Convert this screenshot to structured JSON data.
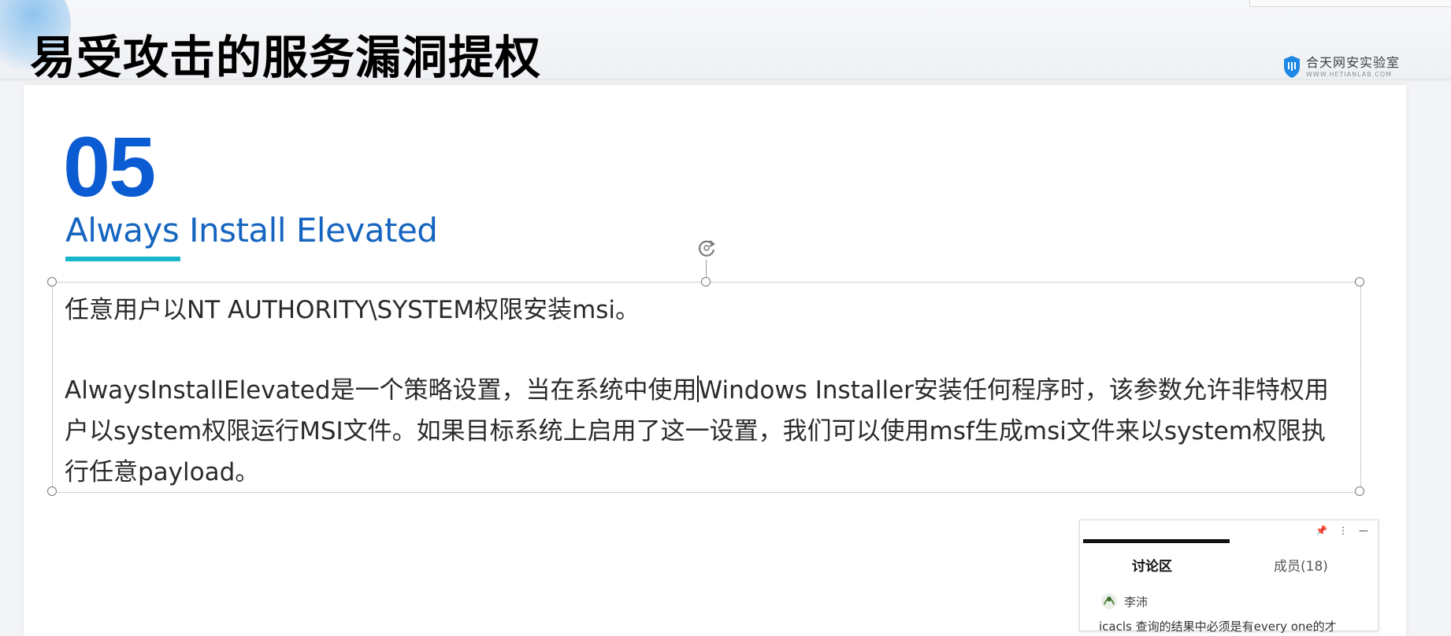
{
  "header": {
    "title": "易受攻击的服务漏洞提权",
    "logo_name": "合天网安实验室",
    "logo_url": "WWW.HETIANLAB.COM"
  },
  "slide": {
    "number": "05",
    "title": "Always Install Elevated",
    "paragraph1": "任意用户以NT AUTHORITY\\SYSTEM权限安装msi。",
    "paragraph2_before_cursor": "AlwaysInstallElevated是一个策略设置，当在系统中使用",
    "paragraph2_after_cursor": "Windows Installer安装任何程序时，该参数允许非特权用户以system权限运行MSI文件。如果目标系统上启用了这一设置，我们可以使用msf生成msi文件来以system权限执行任意payload。"
  },
  "chat": {
    "tabs": [
      {
        "label": "讨论区",
        "active": true
      },
      {
        "label": "成员(18)",
        "active": false
      }
    ],
    "messages": [
      {
        "user": "李沛",
        "text": "icacls 查询的结果中必须是有every one的才"
      }
    ]
  },
  "colors": {
    "number": "#0b5bd3",
    "title": "#1565c0",
    "accent_bar": "#18b7c9"
  }
}
